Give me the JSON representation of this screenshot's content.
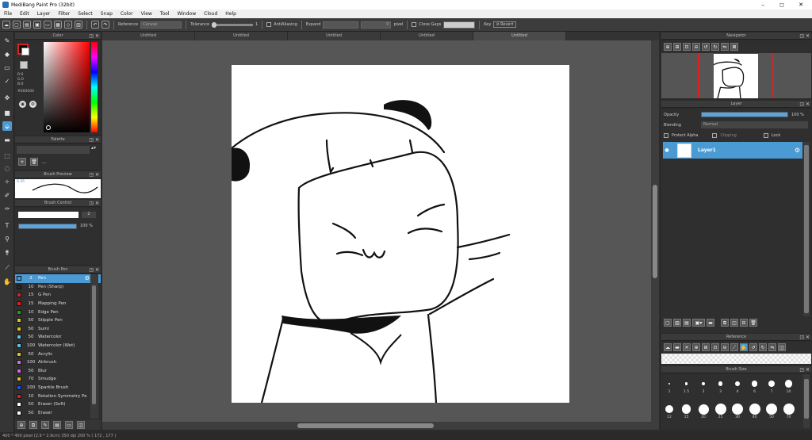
{
  "window": {
    "title": "MediBang Paint Pro (32bit)",
    "minimize": "–",
    "maximize": "◻",
    "close": "✕"
  },
  "menu": [
    "File",
    "Edit",
    "Layer",
    "Filter",
    "Select",
    "Snap",
    "Color",
    "View",
    "Tool",
    "Window",
    "Cloud",
    "Help"
  ],
  "toolbar": {
    "reference_label": "Reference",
    "reference_value": "Canvas",
    "tolerance_label": "Tolerance",
    "tolerance_value": "1",
    "antialiasing_label": "AntiAliasing",
    "expand_label": "Expand",
    "expand_value": "0",
    "expand_unit": "pixel",
    "close_gaps_label": "Close Gaps",
    "key_label": "Key",
    "revert_label": "Revert"
  },
  "tabs": [
    "Untitled",
    "Untitled",
    "Untitled",
    "Untitled",
    "Untitled"
  ],
  "color_panel": {
    "title": "Color",
    "r": "R:0",
    "g": "G:0",
    "b": "B:0",
    "hex": "#000000",
    "primary": "#000000",
    "secondary": "#ffffff",
    "accent": "#e02020"
  },
  "palette_panel": {
    "title": "Palette",
    "add": "+",
    "delete": "🗑",
    "more": "..."
  },
  "brush_preview": {
    "title": "Brush Preview",
    "size": "0.35"
  },
  "brush_control": {
    "title": "Brush Control",
    "size_value": "2",
    "opacity_value": "100 %",
    "opacity": 1.0
  },
  "brush_list": {
    "title": "Brush Pen",
    "items": [
      {
        "color": "#4a9ad4",
        "size": "2",
        "name": "Pen"
      },
      {
        "color": "#2a2a2a",
        "size": "10",
        "name": "Pen (Sharp)"
      },
      {
        "color": "#e02020",
        "size": "15",
        "name": "G Pen"
      },
      {
        "color": "#e02020",
        "size": "15",
        "name": "Mapping Pen"
      },
      {
        "color": "#20a020",
        "size": "10",
        "name": "Edge Pen"
      },
      {
        "color": "#e0c020",
        "size": "50",
        "name": "Stipple Pen"
      },
      {
        "color": "#e0c020",
        "size": "50",
        "name": "Sumi"
      },
      {
        "color": "#60c0e0",
        "size": "50",
        "name": "Watercolor"
      },
      {
        "color": "#60c0e0",
        "size": "100",
        "name": "Watercolor (Wet)"
      },
      {
        "color": "#e0c020",
        "size": "50",
        "name": "Acrylic"
      },
      {
        "color": "#d070d0",
        "size": "100",
        "name": "Airbrush"
      },
      {
        "color": "#d070d0",
        "size": "50",
        "name": "Blur"
      },
      {
        "color": "#e0c020",
        "size": "70",
        "name": "Smudge"
      },
      {
        "color": "#3050d0",
        "size": "100",
        "name": "Sparkle Brush"
      },
      {
        "color": "#e02020",
        "size": "10",
        "name": "Rotation Symmetry Pe"
      },
      {
        "color": "#ffffff",
        "size": "50",
        "name": "Eraser (Soft)"
      },
      {
        "color": "#ffffff",
        "size": "50",
        "name": "Eraser"
      }
    ]
  },
  "navigator": {
    "title": "Navigator"
  },
  "layer_panel": {
    "title": "Layer",
    "opacity_label": "Opacity",
    "opacity_value": "100 %",
    "opacity": 1.0,
    "blending_label": "Blending",
    "blending_value": "Normal",
    "protect_alpha": "Protect Alpha",
    "clipping": "Clipping",
    "lock": "Lock",
    "layers": [
      {
        "name": "Layer1"
      }
    ]
  },
  "reference_panel": {
    "title": "Reference"
  },
  "brush_size_panel": {
    "title": "Brush Size",
    "sizes": [
      "1",
      "1.5",
      "2",
      "3",
      "4",
      "6",
      "7",
      "10",
      "12",
      "15",
      "20",
      "25",
      "30",
      "40",
      "50",
      "70"
    ]
  },
  "status": "400 * 400 pixel  (2.9 * 2.9cm)  350 dpi  200 %  ( 172 , 177 )"
}
